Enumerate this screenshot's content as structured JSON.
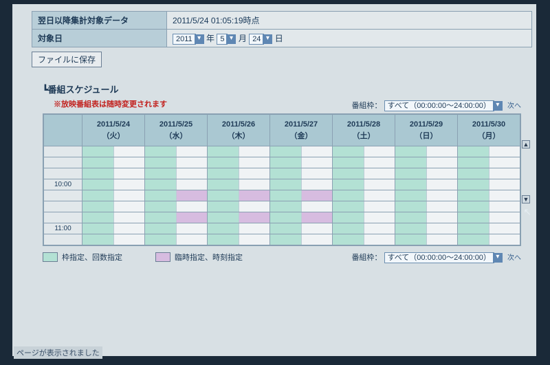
{
  "info": {
    "row1_label": "翌日以降集計対象データ",
    "row1_value": "2011/5/24 01:05:19時点",
    "row2_label": "対象日",
    "year": "2011",
    "year_suffix": "年",
    "month": "5",
    "month_suffix": "月",
    "day": "24",
    "day_suffix": "日"
  },
  "buttons": {
    "save_file": "ファイルに保存"
  },
  "section": {
    "title": "番組スケジュール",
    "warning": "※放映番組表は随時変更されます"
  },
  "filter": {
    "label": "番組枠：",
    "value": "すべて（00:00:00～24:00:00）",
    "next": "次へ"
  },
  "schedule": {
    "time_rows": [
      "",
      "",
      "",
      "10:00",
      "",
      "",
      "",
      "11:00",
      ""
    ],
    "days": [
      {
        "date": "2011/5/24",
        "dow": "（火）"
      },
      {
        "date": "2011/5/25",
        "dow": "（水）"
      },
      {
        "date": "2011/5/26",
        "dow": "（木）"
      },
      {
        "date": "2011/5/27",
        "dow": "（金）"
      },
      {
        "date": "2011/5/28",
        "dow": "（土）"
      },
      {
        "date": "2011/5/29",
        "dow": "（日）"
      },
      {
        "date": "2011/5/30",
        "dow": "（月）"
      }
    ],
    "cells": [
      [
        [
          "g",
          ""
        ],
        [
          "g",
          ""
        ],
        [
          "g",
          ""
        ],
        [
          "g",
          ""
        ],
        [
          "g",
          ""
        ],
        [
          "g",
          ""
        ],
        [
          "g",
          ""
        ]
      ],
      [
        [
          "g",
          ""
        ],
        [
          "g",
          ""
        ],
        [
          "g",
          ""
        ],
        [
          "g",
          ""
        ],
        [
          "g",
          ""
        ],
        [
          "g",
          ""
        ],
        [
          "g",
          ""
        ]
      ],
      [
        [
          "g",
          ""
        ],
        [
          "g",
          ""
        ],
        [
          "g",
          ""
        ],
        [
          "g",
          ""
        ],
        [
          "g",
          ""
        ],
        [
          "g",
          ""
        ],
        [
          "g",
          ""
        ]
      ],
      [
        [
          "g",
          ""
        ],
        [
          "g",
          ""
        ],
        [
          "g",
          ""
        ],
        [
          "g",
          ""
        ],
        [
          "g",
          ""
        ],
        [
          "g",
          ""
        ],
        [
          "g",
          ""
        ]
      ],
      [
        [
          "g",
          ""
        ],
        [
          "g",
          "p"
        ],
        [
          "g",
          "p"
        ],
        [
          "g",
          "p"
        ],
        [
          "g",
          ""
        ],
        [
          "g",
          ""
        ],
        [
          "g",
          ""
        ]
      ],
      [
        [
          "g",
          ""
        ],
        [
          "g",
          ""
        ],
        [
          "g",
          ""
        ],
        [
          "g",
          ""
        ],
        [
          "g",
          ""
        ],
        [
          "g",
          ""
        ],
        [
          "g",
          ""
        ]
      ],
      [
        [
          "g",
          ""
        ],
        [
          "g",
          "p"
        ],
        [
          "g",
          "p"
        ],
        [
          "g",
          "p"
        ],
        [
          "g",
          ""
        ],
        [
          "g",
          ""
        ],
        [
          "g",
          ""
        ]
      ],
      [
        [
          "g",
          ""
        ],
        [
          "g",
          ""
        ],
        [
          "g",
          ""
        ],
        [
          "g",
          ""
        ],
        [
          "g",
          ""
        ],
        [
          "g",
          ""
        ],
        [
          "g",
          ""
        ]
      ],
      [
        [
          "g",
          ""
        ],
        [
          "g",
          ""
        ],
        [
          "g",
          ""
        ],
        [
          "g",
          ""
        ],
        [
          "g",
          ""
        ],
        [
          "g",
          ""
        ],
        [
          "g",
          ""
        ]
      ]
    ]
  },
  "legend": {
    "green": "枠指定、回数指定",
    "pink": "臨時指定、時刻指定"
  },
  "status_bar": "ページが表示されました"
}
